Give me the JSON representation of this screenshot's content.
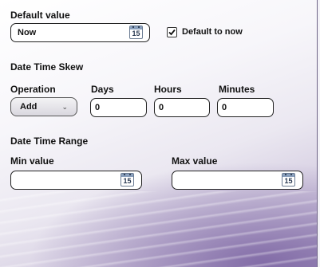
{
  "default_value": {
    "label": "Default value",
    "value": "Now",
    "calendar_day": "15",
    "default_to_now_label": "Default to now",
    "default_to_now_checked": true
  },
  "skew": {
    "heading": "Date Time Skew",
    "operation_label": "Operation",
    "operation_value": "Add",
    "days_label": "Days",
    "days_value": "0",
    "hours_label": "Hours",
    "hours_value": "0",
    "minutes_label": "Minutes",
    "minutes_value": "0"
  },
  "range": {
    "heading": "Date Time Range",
    "min_label": "Min value",
    "min_value": "",
    "max_label": "Max value",
    "max_value": "",
    "calendar_day": "15"
  },
  "icons": {
    "calendar": "calendar-icon",
    "check": "check-icon",
    "chevron": "chevron-down-icon"
  }
}
